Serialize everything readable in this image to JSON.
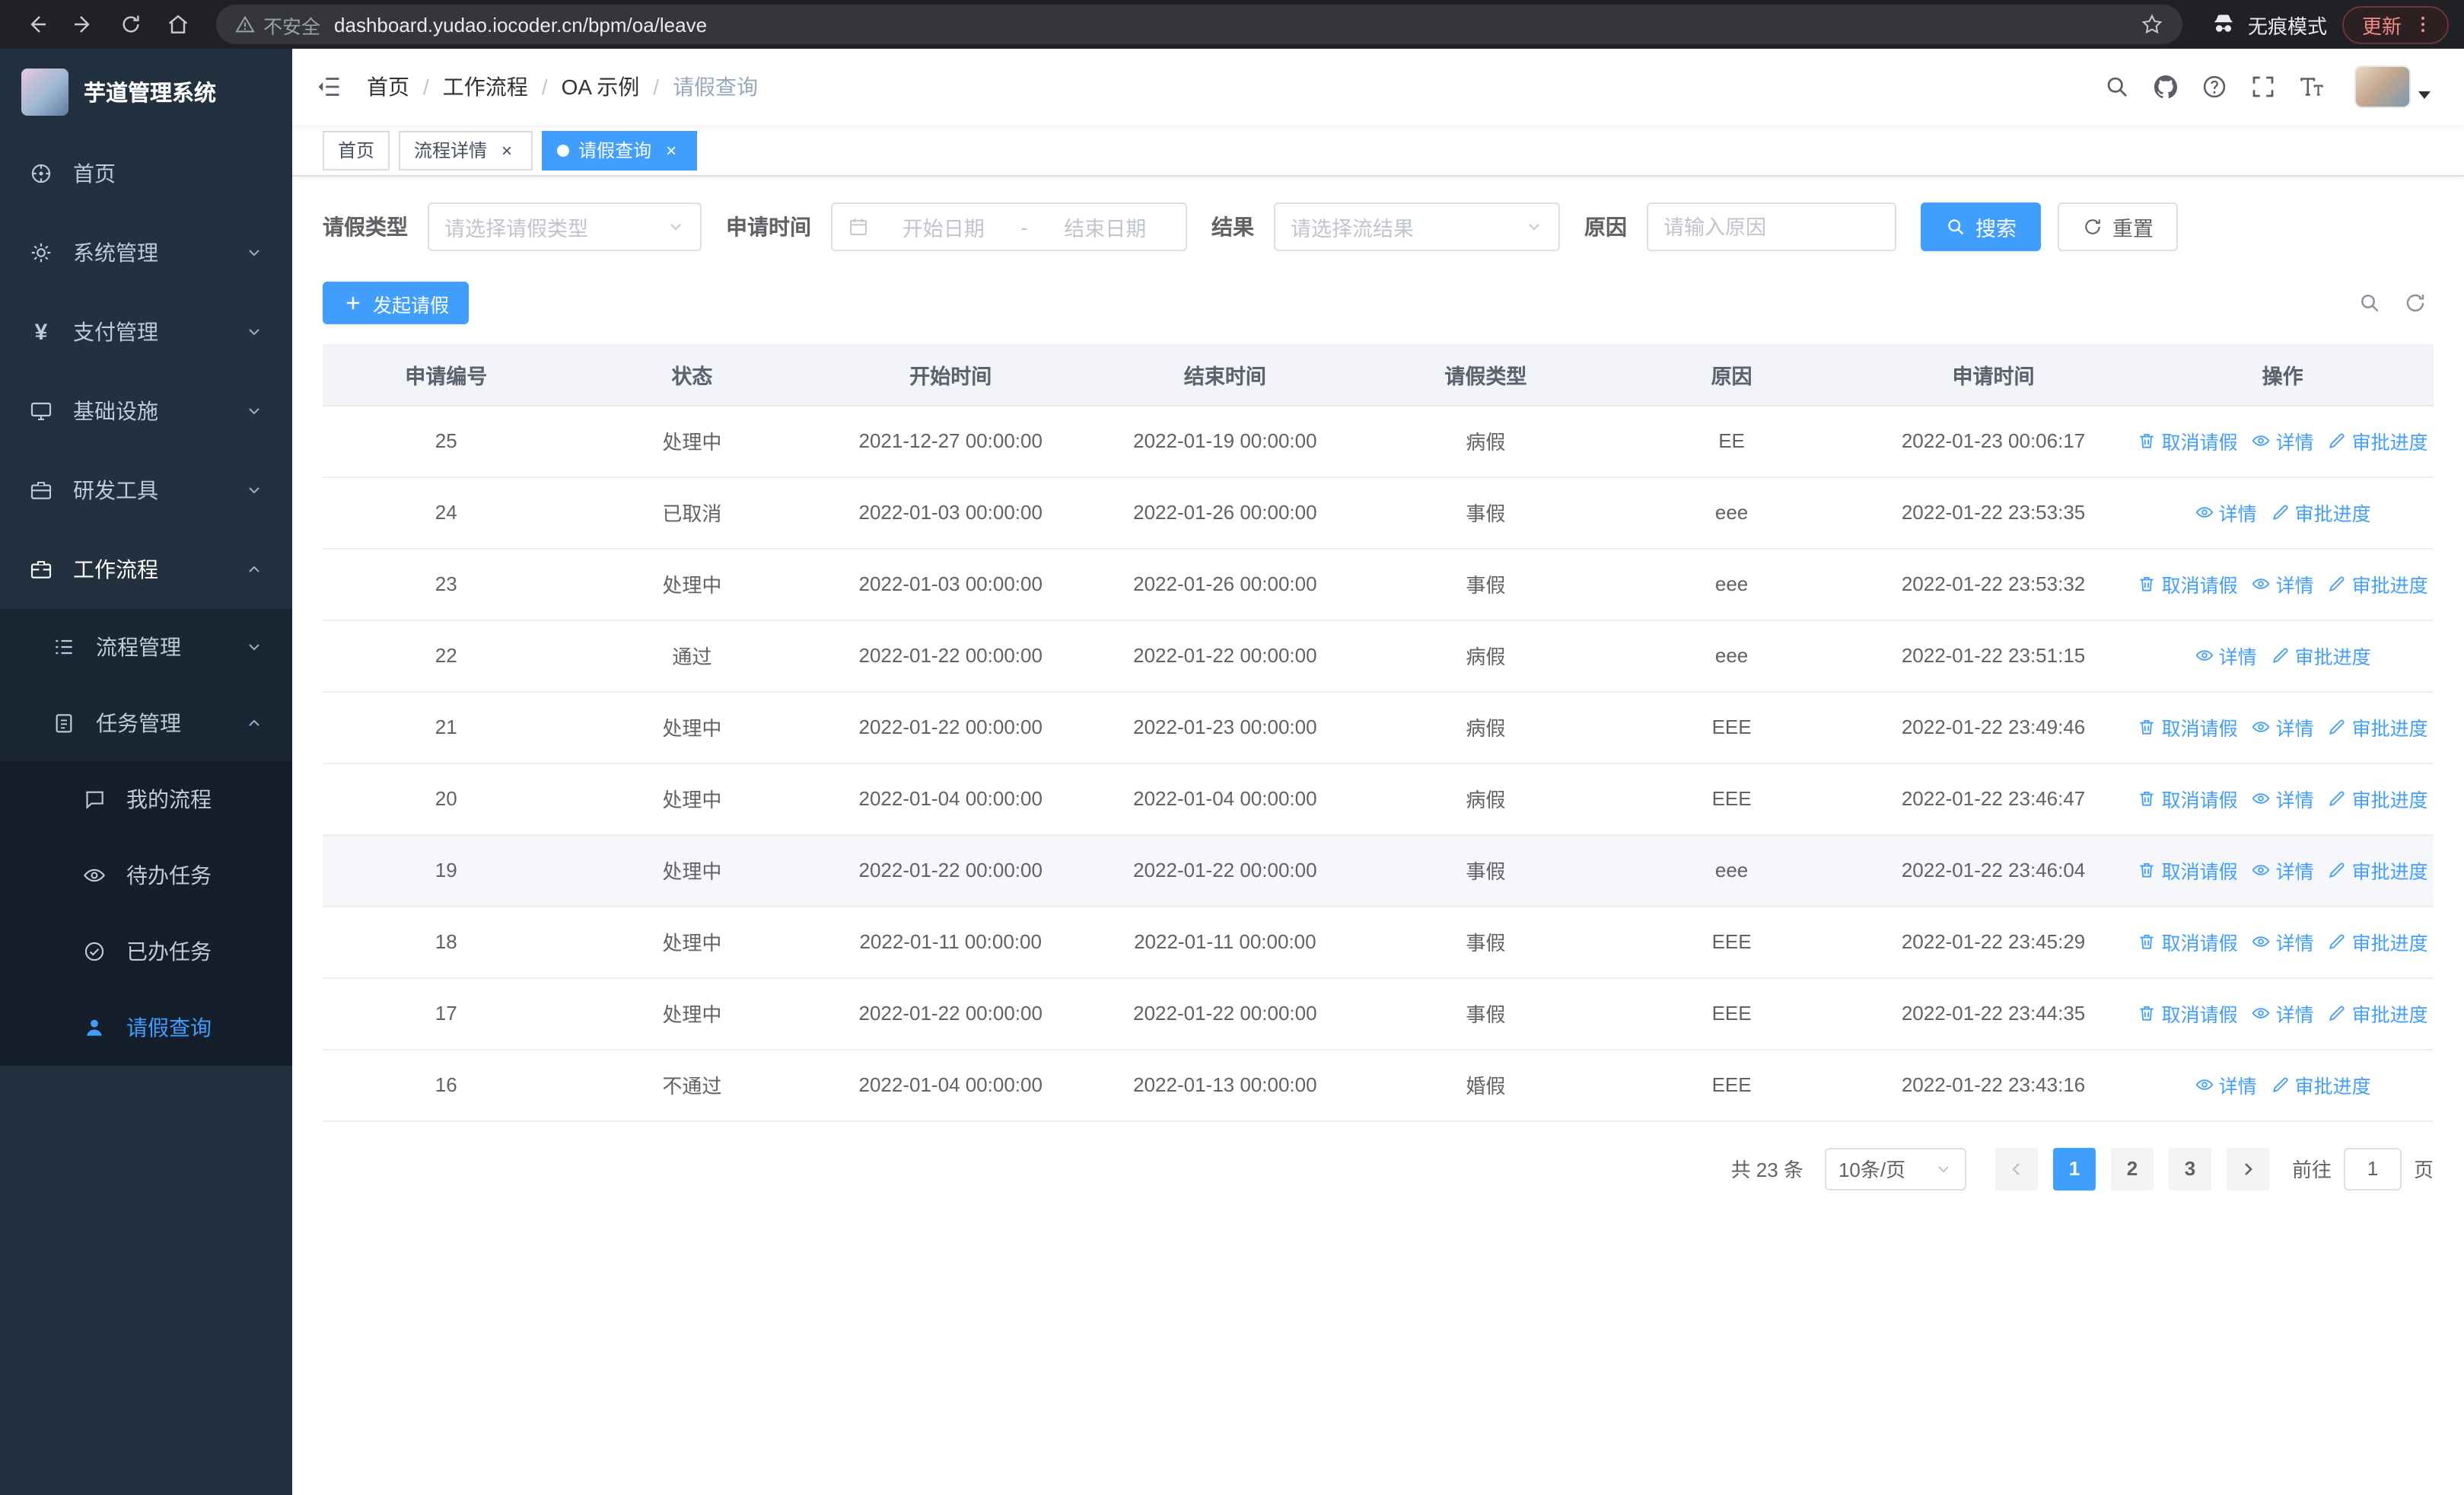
{
  "colors": {
    "primary": "#409EFF",
    "sidebar_bg": "#22303f",
    "sidebar_submenu_bg": "#1a2634",
    "active_tab_bg": "#409EFF",
    "table_header_bg": "#f3f4f7",
    "browser_bar_bg": "#202124",
    "update_chip_text": "#f28b82"
  },
  "icons": {
    "browser": [
      "back-arrow",
      "forward-arrow",
      "reload",
      "home",
      "warning-triangle",
      "star",
      "incognito-spy",
      "kebab-menu"
    ],
    "navbar": [
      "menu-fold",
      "search",
      "github",
      "question-circle",
      "fullscreen",
      "font-size",
      "caret-down"
    ],
    "sidebar": [
      "dashboard-wheel",
      "gear",
      "yen",
      "monitor",
      "toolbox",
      "briefcase",
      "list",
      "clipboard",
      "chat-bubble",
      "eye",
      "check-circle",
      "user"
    ],
    "filters": [
      "chevron-down",
      "calendar",
      "magnifier",
      "refresh"
    ],
    "table_actions": [
      "trash",
      "eye",
      "edit-pen"
    ],
    "pagination": [
      "chevron-left",
      "chevron-right",
      "chevron-down"
    ]
  },
  "browser": {
    "security": "不安全",
    "url": "dashboard.yudao.iocoder.cn/bpm/oa/leave",
    "incognito": "无痕模式",
    "update": "更新"
  },
  "sidebar": {
    "title": "芋道管理系统",
    "menu": [
      {
        "label": "首页"
      },
      {
        "label": "系统管理"
      },
      {
        "label": "支付管理"
      },
      {
        "label": "基础设施"
      },
      {
        "label": "研发工具"
      },
      {
        "label": "工作流程"
      },
      {
        "label": "流程管理"
      },
      {
        "label": "任务管理"
      },
      {
        "label": "我的流程"
      },
      {
        "label": "待办任务"
      },
      {
        "label": "已办任务"
      },
      {
        "label": "请假查询"
      }
    ]
  },
  "breadcrumb": [
    "首页",
    "工作流程",
    "OA 示例",
    "请假查询"
  ],
  "tabs": [
    {
      "label": "首页"
    },
    {
      "label": "流程详情"
    },
    {
      "label": "请假查询"
    }
  ],
  "filters": {
    "leave_type_label": "请假类型",
    "leave_type_placeholder": "请选择请假类型",
    "apply_time_label": "申请时间",
    "start_date_placeholder": "开始日期",
    "range_separator": "-",
    "end_date_placeholder": "结束日期",
    "result_label": "结果",
    "result_placeholder": "请选择流结果",
    "reason_label": "原因",
    "reason_placeholder": "请输入原因",
    "search_button": "搜索",
    "reset_button": "重置"
  },
  "toolbar": {
    "create_button": "发起请假"
  },
  "table": {
    "columns": [
      "申请编号",
      "状态",
      "开始时间",
      "结束时间",
      "请假类型",
      "原因",
      "申请时间",
      "操作"
    ],
    "action_labels": {
      "cancel": "取消请假",
      "detail": "详情",
      "progress": "审批进度"
    },
    "rows": [
      {
        "id": "25",
        "status": "处理中",
        "start": "2021-12-27 00:00:00",
        "end": "2022-01-19 00:00:00",
        "type": "病假",
        "reason": "EE",
        "applied": "2022-01-23 00:06:17",
        "cancellable": true,
        "highlight": false
      },
      {
        "id": "24",
        "status": "已取消",
        "start": "2022-01-03 00:00:00",
        "end": "2022-01-26 00:00:00",
        "type": "事假",
        "reason": "eee",
        "applied": "2022-01-22 23:53:35",
        "cancellable": false,
        "highlight": false
      },
      {
        "id": "23",
        "status": "处理中",
        "start": "2022-01-03 00:00:00",
        "end": "2022-01-26 00:00:00",
        "type": "事假",
        "reason": "eee",
        "applied": "2022-01-22 23:53:32",
        "cancellable": true,
        "highlight": false
      },
      {
        "id": "22",
        "status": "通过",
        "start": "2022-01-22 00:00:00",
        "end": "2022-01-22 00:00:00",
        "type": "病假",
        "reason": "eee",
        "applied": "2022-01-22 23:51:15",
        "cancellable": false,
        "highlight": false
      },
      {
        "id": "21",
        "status": "处理中",
        "start": "2022-01-22 00:00:00",
        "end": "2022-01-23 00:00:00",
        "type": "病假",
        "reason": "EEE",
        "applied": "2022-01-22 23:49:46",
        "cancellable": true,
        "highlight": false
      },
      {
        "id": "20",
        "status": "处理中",
        "start": "2022-01-04 00:00:00",
        "end": "2022-01-04 00:00:00",
        "type": "病假",
        "reason": "EEE",
        "applied": "2022-01-22 23:46:47",
        "cancellable": true,
        "highlight": false
      },
      {
        "id": "19",
        "status": "处理中",
        "start": "2022-01-22 00:00:00",
        "end": "2022-01-22 00:00:00",
        "type": "事假",
        "reason": "eee",
        "applied": "2022-01-22 23:46:04",
        "cancellable": true,
        "highlight": true
      },
      {
        "id": "18",
        "status": "处理中",
        "start": "2022-01-11 00:00:00",
        "end": "2022-01-11 00:00:00",
        "type": "事假",
        "reason": "EEE",
        "applied": "2022-01-22 23:45:29",
        "cancellable": true,
        "highlight": false
      },
      {
        "id": "17",
        "status": "处理中",
        "start": "2022-01-22 00:00:00",
        "end": "2022-01-22 00:00:00",
        "type": "事假",
        "reason": "EEE",
        "applied": "2022-01-22 23:44:35",
        "cancellable": true,
        "highlight": false
      },
      {
        "id": "16",
        "status": "不通过",
        "start": "2022-01-04 00:00:00",
        "end": "2022-01-13 00:00:00",
        "type": "婚假",
        "reason": "EEE",
        "applied": "2022-01-22 23:43:16",
        "cancellable": false,
        "highlight": false
      }
    ]
  },
  "pagination": {
    "total": "共 23 条",
    "page_size": "10条/页",
    "pages": [
      "1",
      "2",
      "3"
    ],
    "active_page": "1",
    "goto_label": "前往",
    "goto_value": "1",
    "page_label": "页"
  }
}
